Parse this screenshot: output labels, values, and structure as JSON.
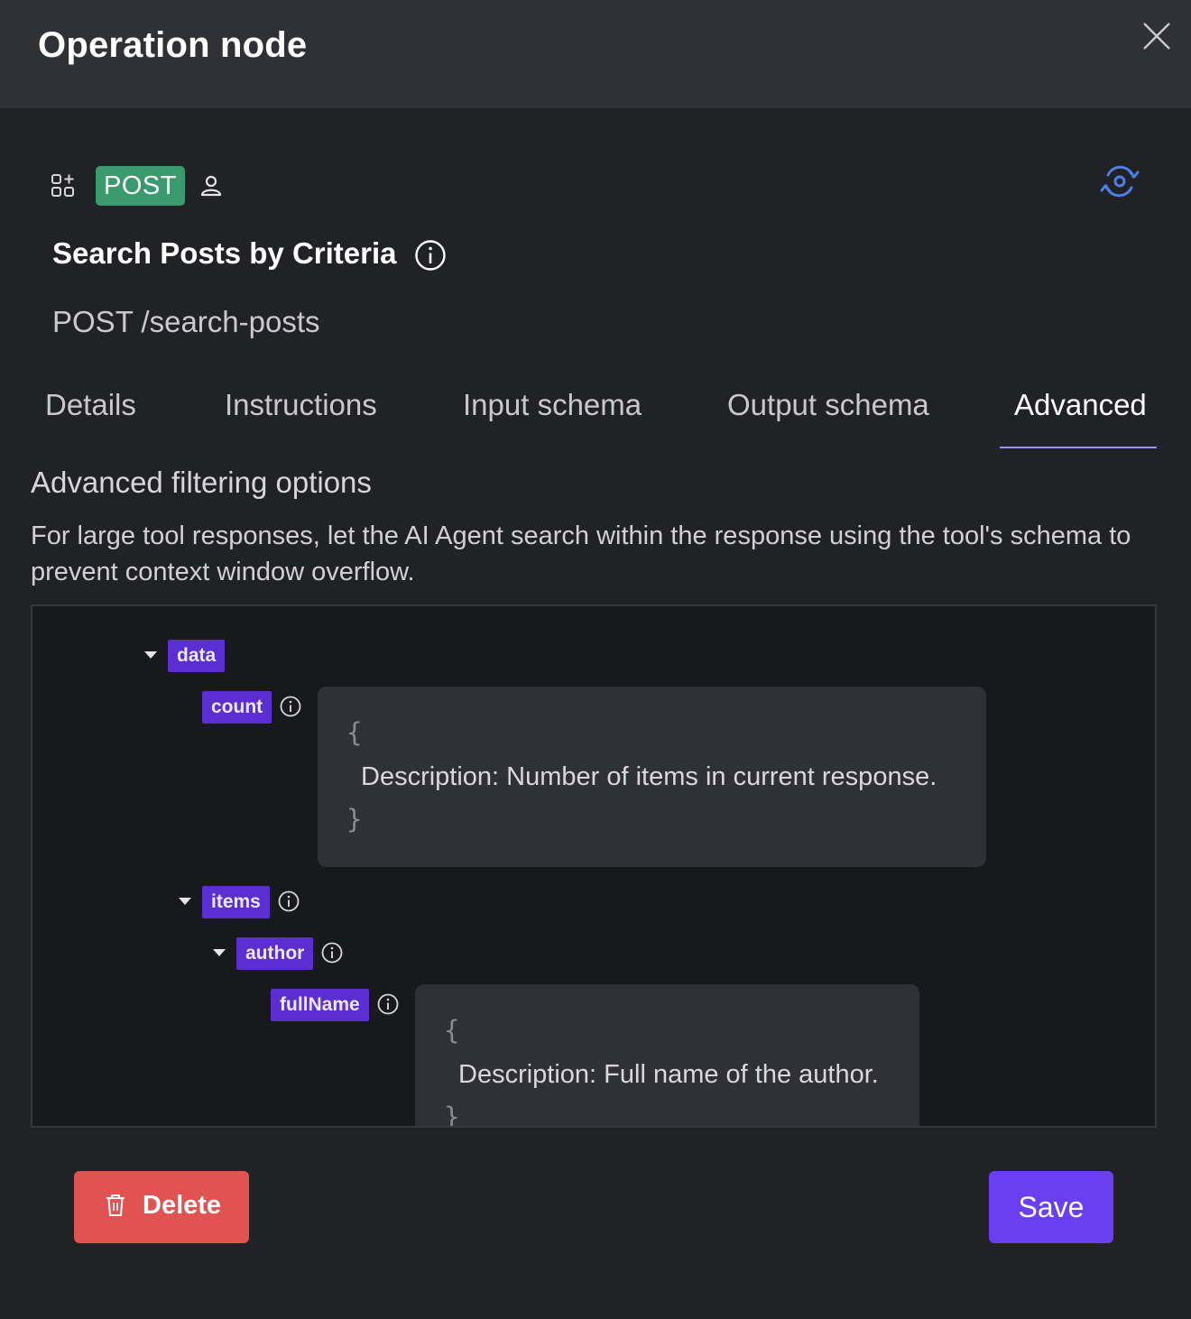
{
  "header": {
    "title": "Operation node",
    "close_icon": "close-icon"
  },
  "operation": {
    "method": "POST",
    "method_color": "#3a9a6e",
    "name": "Search Posts by Criteria",
    "path": "POST /search-posts",
    "icons": [
      "grid-add-icon",
      "user-icon",
      "refresh-icon",
      "info-icon"
    ]
  },
  "tabs": [
    {
      "label": "Details",
      "active": false
    },
    {
      "label": "Instructions",
      "active": false
    },
    {
      "label": "Input schema",
      "active": false
    },
    {
      "label": "Output schema",
      "active": false
    },
    {
      "label": "Advanced",
      "active": true
    }
  ],
  "advanced": {
    "title": "Advanced filtering options",
    "description": "For large tool responses, let the AI Agent search within the response using the tool's schema to prevent context window overflow."
  },
  "schema_tree": {
    "nodes": [
      {
        "label": "data",
        "expanded": true
      },
      {
        "label": "count",
        "description": "Description: Number of items in current response."
      },
      {
        "label": "items",
        "expanded": true
      },
      {
        "label": "author",
        "expanded": true
      },
      {
        "label": "fullName",
        "description": "Description: Full name of the author."
      }
    ],
    "open_brace": "{",
    "close_brace": "}"
  },
  "footer": {
    "delete_label": "Delete",
    "save_label": "Save",
    "delete_color": "#e05350",
    "save_color": "#6a3ff2"
  }
}
